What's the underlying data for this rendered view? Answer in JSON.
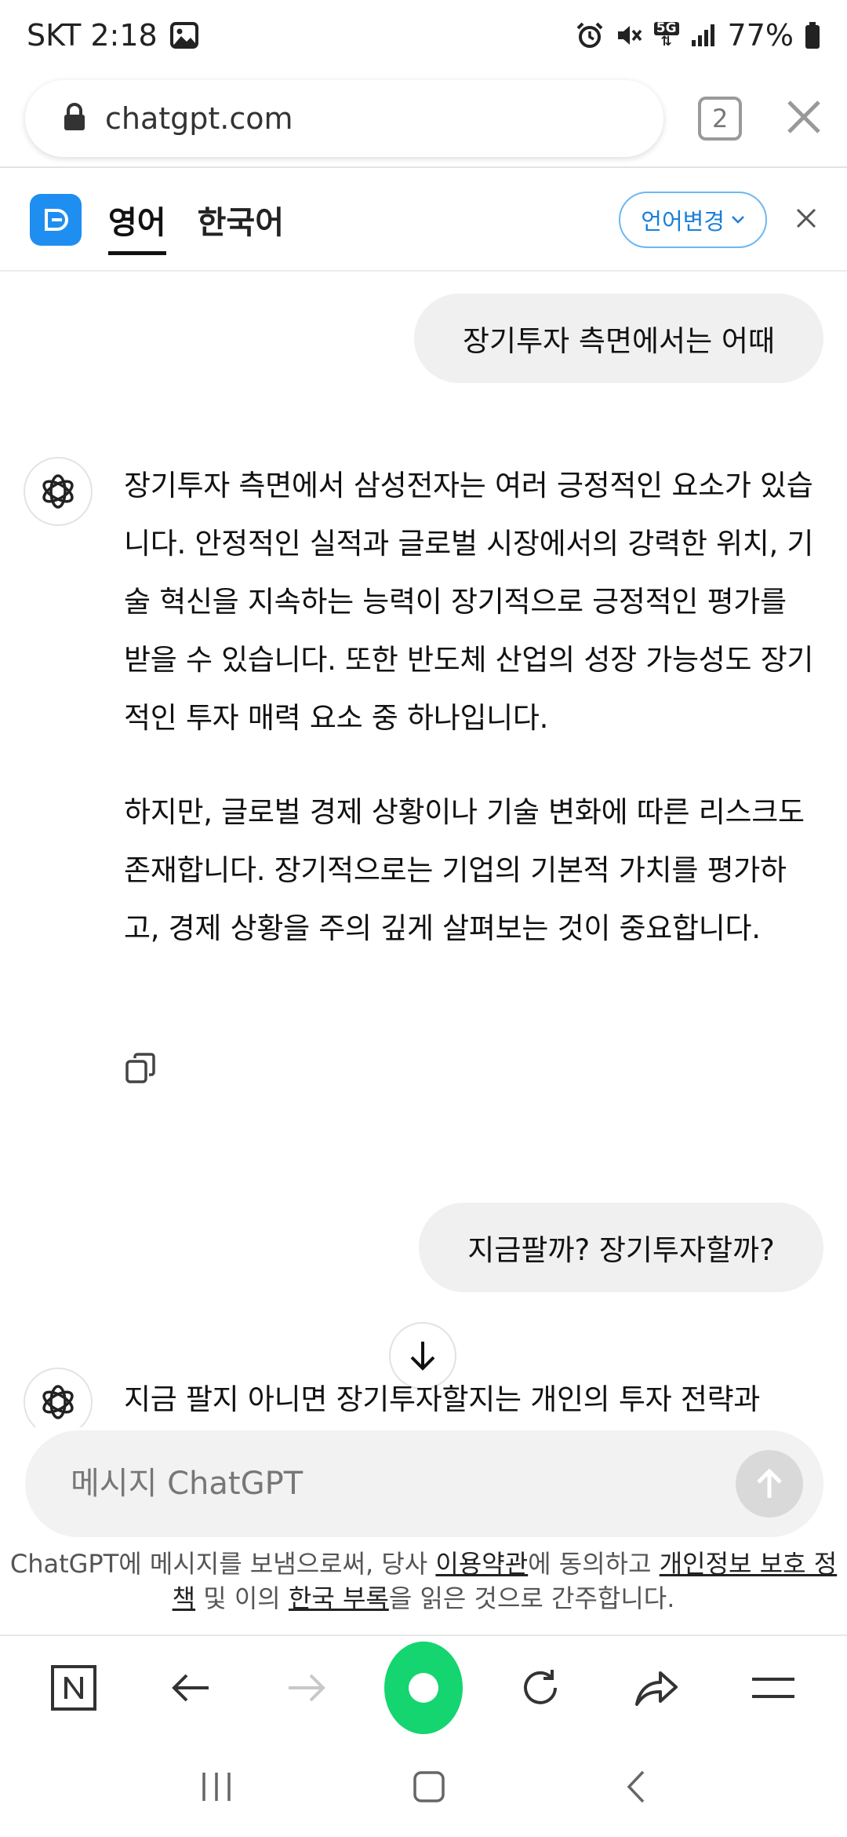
{
  "status_bar": {
    "carrier_time": "SKT 2:18",
    "battery": "77%",
    "network": "5G"
  },
  "browser": {
    "url": "chatgpt.com",
    "tab_count": "2"
  },
  "translation_bar": {
    "source_lang": "영어",
    "target_lang": "한국어",
    "change_label": "언어변경"
  },
  "chat": {
    "messages": [
      {
        "role": "user",
        "text": "장기투자 측면에서는 어때"
      },
      {
        "role": "assistant",
        "paragraphs": [
          "장기투자 측면에서 삼성전자는 여러 긍정적인 요소가 있습니다. 안정적인 실적과 글로벌 시장에서의 강력한 위치, 기술 혁신을 지속하는 능력이 장기적으로 긍정적인 평가를 받을 수 있습니다. 또한 반도체 산업의 성장 가능성도 장기적인 투자 매력 요소 중 하나입니다.",
          "하지만, 글로벌 경제 상황이나 기술 변화에 따른 리스크도 존재합니다. 장기적으로는 기업의 기본적 가치를 평가하고, 경제 상황을 주의 깊게 살펴보는 것이 중요합니다."
        ]
      },
      {
        "role": "user",
        "text": "지금팔까? 장기투자할까?"
      },
      {
        "role": "assistant",
        "paragraphs": [
          "지금 팔지 아니면 장기투자할지는 개인의 투자 전략과"
        ]
      }
    ]
  },
  "input": {
    "placeholder": "메시지 ChatGPT"
  },
  "disclaimer": {
    "part1": "ChatGPT에 메시지를 보냄으로써, 당사 ",
    "terms_link": "이용약관",
    "part2": "에 동의하고 ",
    "privacy_link": "개인정보 보호 정책",
    "part3": " 및 이의 ",
    "korea_link": "한국 부록",
    "part4": "을 읽은 것으로 간주합니다."
  },
  "icons": {
    "status": [
      "image-icon",
      "alarm-icon",
      "mute-icon",
      "5g-icon",
      "signal-icon",
      "battery-icon"
    ],
    "bottom_nav": [
      "naver-n-icon",
      "back-arrow-icon",
      "forward-arrow-icon",
      "green-dot-icon",
      "refresh-icon",
      "share-icon",
      "menu-icon"
    ],
    "system_nav": [
      "recent-apps-icon",
      "home-icon",
      "back-icon"
    ]
  },
  "colors": {
    "accent_blue": "#1f8ef1",
    "green": "#14d56f",
    "bubble": "#f0f0f0"
  }
}
